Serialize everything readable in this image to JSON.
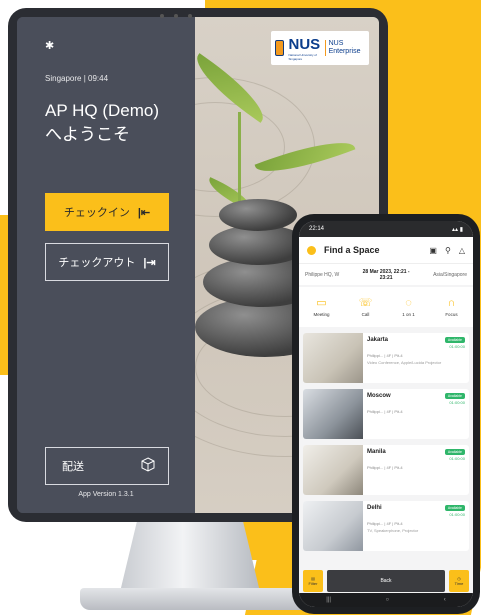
{
  "kiosk": {
    "location_time": "Singapore | 09:44",
    "site_name": "AP HQ (Demo)",
    "welcome": "へようこそ",
    "checkin_label": "チェックイン",
    "checkout_label": "チェックアウト",
    "delivery_label": "配送",
    "app_version": "App Version 1.3.1",
    "logo_nus": "NUS",
    "logo_sub": "National University of Singapore",
    "logo_enterprise": "NUS Enterprise",
    "accent_color": "#fbbf1a"
  },
  "mobile": {
    "status_time": "22:14",
    "title": "Find a Space",
    "location_left": "Philippe HQ, W",
    "date_range": "28 Mar 2023, 22:21 - 23:21",
    "location_right": "Asia/Singapore",
    "categories": [
      {
        "label": "Meeting",
        "icon": "meeting-icon"
      },
      {
        "label": "Call",
        "icon": "call-icon"
      },
      {
        "label": "1 on 1",
        "icon": "chat-icon"
      },
      {
        "label": "Focus",
        "icon": "headset-icon"
      }
    ],
    "spaces": [
      {
        "name": "Jakarta",
        "status": "Available",
        "time": "01:00:00",
        "meta": "Philippi... | 4F | Pit-4",
        "desc": "Video Conference, Apple/Lucida Projector"
      },
      {
        "name": "Moscow",
        "status": "Available",
        "time": "01:00:00",
        "meta": "Philippi... | 4F | Pit-4",
        "desc": ""
      },
      {
        "name": "Manila",
        "status": "Available",
        "time": "01:00:00",
        "meta": "Philippi... | 4F | Pit-4",
        "desc": ""
      },
      {
        "name": "Delhi",
        "status": "Available",
        "time": "01:00:00",
        "meta": "Philippi... | 4F | Pit-4",
        "desc": "TV, Speakerphone, Projector"
      }
    ],
    "filter_label": "Filter",
    "back_label": "Back",
    "time_label": "Time",
    "available_color": "#2fb66a"
  }
}
